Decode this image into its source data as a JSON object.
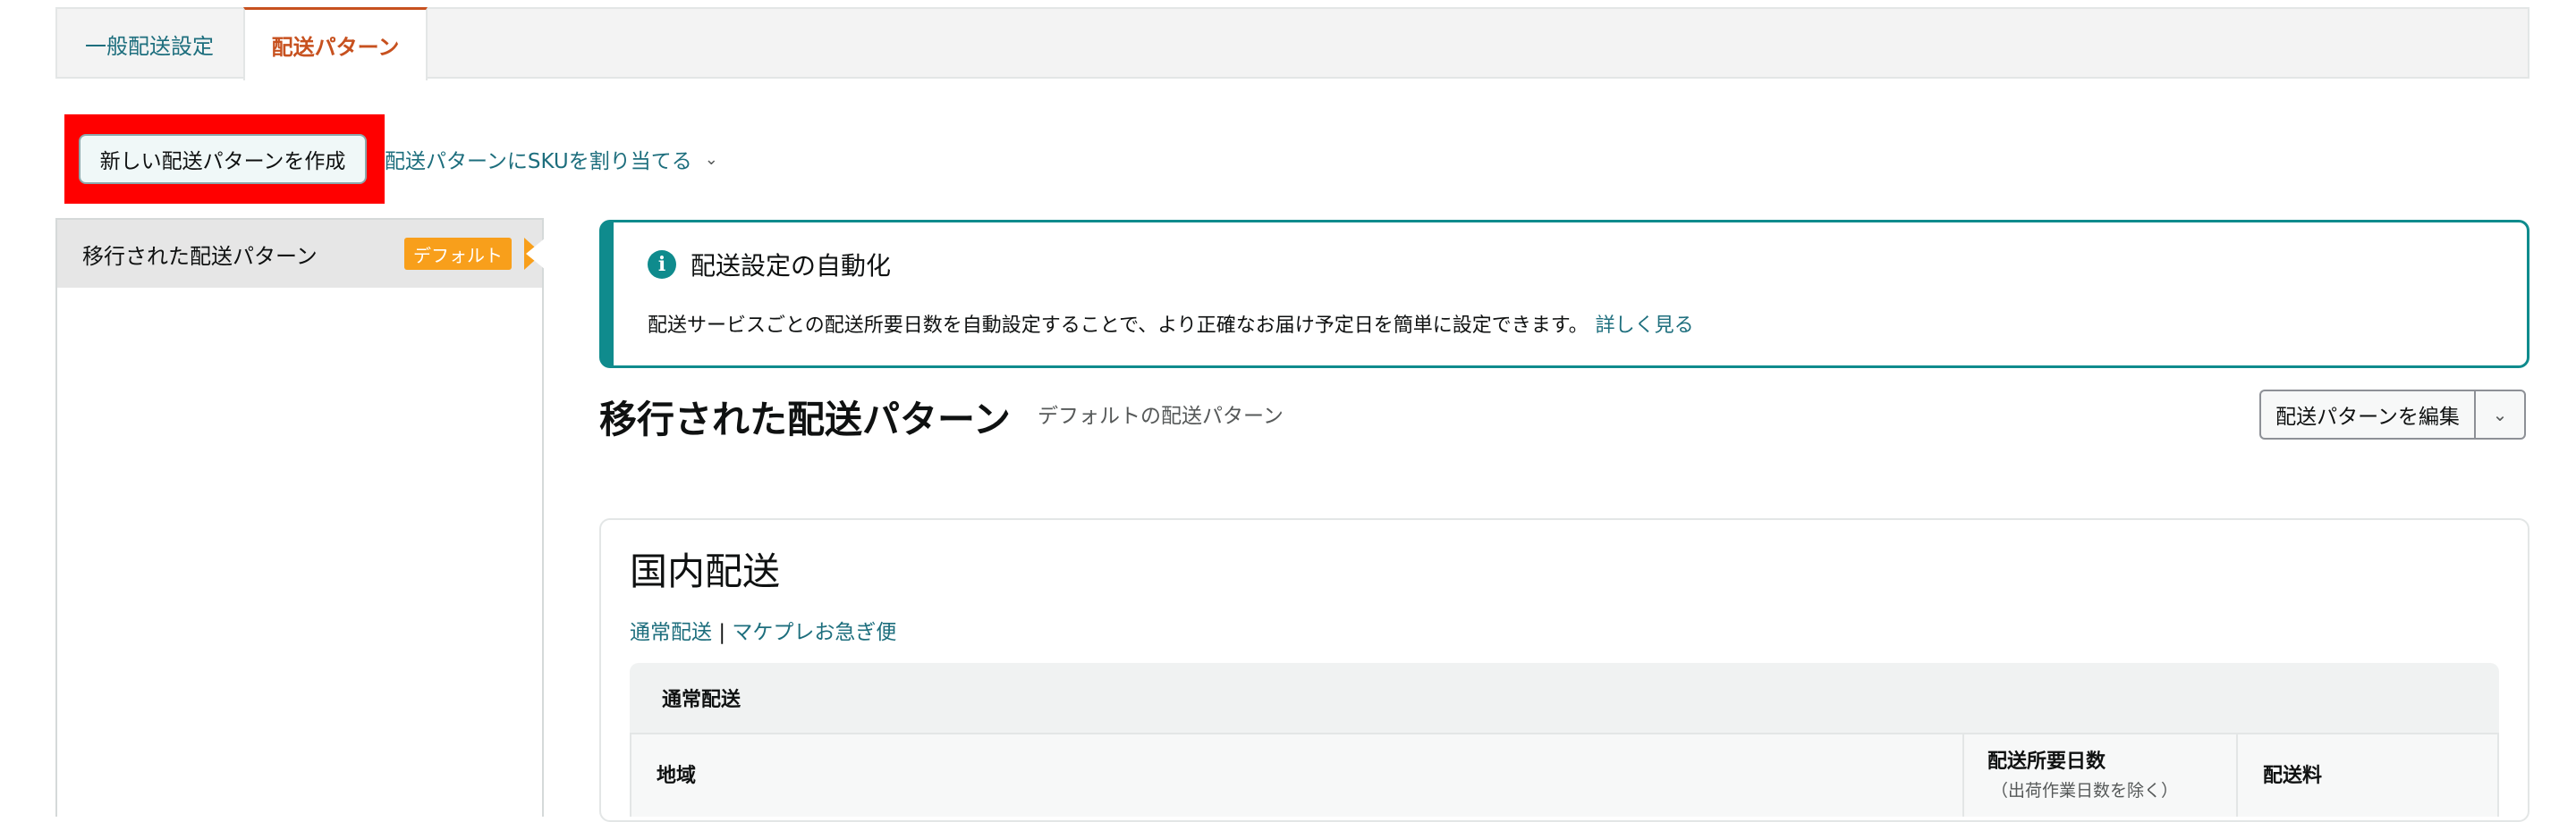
{
  "tabs": {
    "general": "一般配送設定",
    "patterns": "配送パターン"
  },
  "toolbar": {
    "create_label": "新しい配送パターンを作成",
    "assign_label": "配送パターンにSKUを割り当てる",
    "assign_chevron": "⌄"
  },
  "sidebar": {
    "items": [
      {
        "label": "移行された配送パターン",
        "badge": "デフォルト"
      }
    ]
  },
  "alert": {
    "icon": "i",
    "title": "配送設定の自動化",
    "body": "配送サービスごとの配送所要日数を自動設定することで、より正確なお届け予定日を簡単に設定できます。",
    "link": "詳しく見る"
  },
  "header": {
    "title": "移行された配送パターン",
    "subtitle": "デフォルトの配送パターン",
    "edit_label": "配送パターンを編集",
    "dropdown_icon": "⌄"
  },
  "domestic": {
    "title": "国内配送",
    "links": [
      "通常配送",
      "マケプレお急ぎ便"
    ],
    "separator": "|",
    "section_title": "通常配送",
    "columns": {
      "region": "地域",
      "days": "配送所要日数",
      "days_note": "（出荷作業日数を除く）",
      "fee": "配送料"
    }
  },
  "colors": {
    "accent": "#c7511f",
    "link": "#1d6e7d",
    "badge": "#f89f1b",
    "info": "#0f8b8d",
    "highlight": "#ff0000"
  }
}
